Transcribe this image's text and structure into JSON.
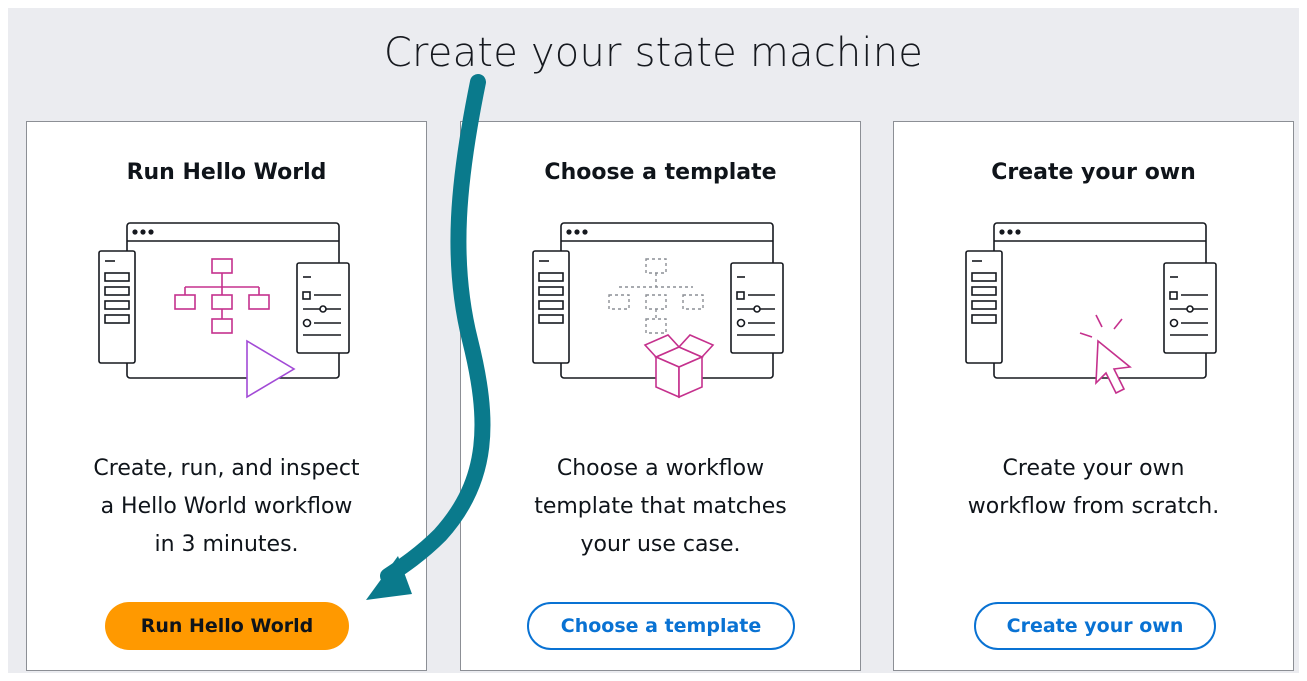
{
  "page": {
    "title": "Create your state machine"
  },
  "cards": [
    {
      "title": "Run Hello World",
      "description": [
        "Create, run, and inspect",
        "a Hello World workflow",
        "in 3 minutes."
      ],
      "button_label": "Run Hello World",
      "button_style": "primary"
    },
    {
      "title": "Choose a template",
      "description": [
        "Choose a workflow",
        "template that matches",
        "your use case."
      ],
      "button_label": "Choose a template",
      "button_style": "secondary"
    },
    {
      "title": "Create your own",
      "description": [
        "Create your own",
        "workflow from scratch."
      ],
      "button_label": "Create your own",
      "button_style": "secondary"
    }
  ],
  "colors": {
    "accent_orange": "#ff9900",
    "link_blue": "#0972d3",
    "illustration_pink": "#c5318d",
    "illustration_purple": "#a24ad6",
    "annotation_teal": "#0a7a8c"
  },
  "icons": [
    "workflow-diagram-icon",
    "play-icon",
    "template-box-icon",
    "cursor-click-icon"
  ]
}
